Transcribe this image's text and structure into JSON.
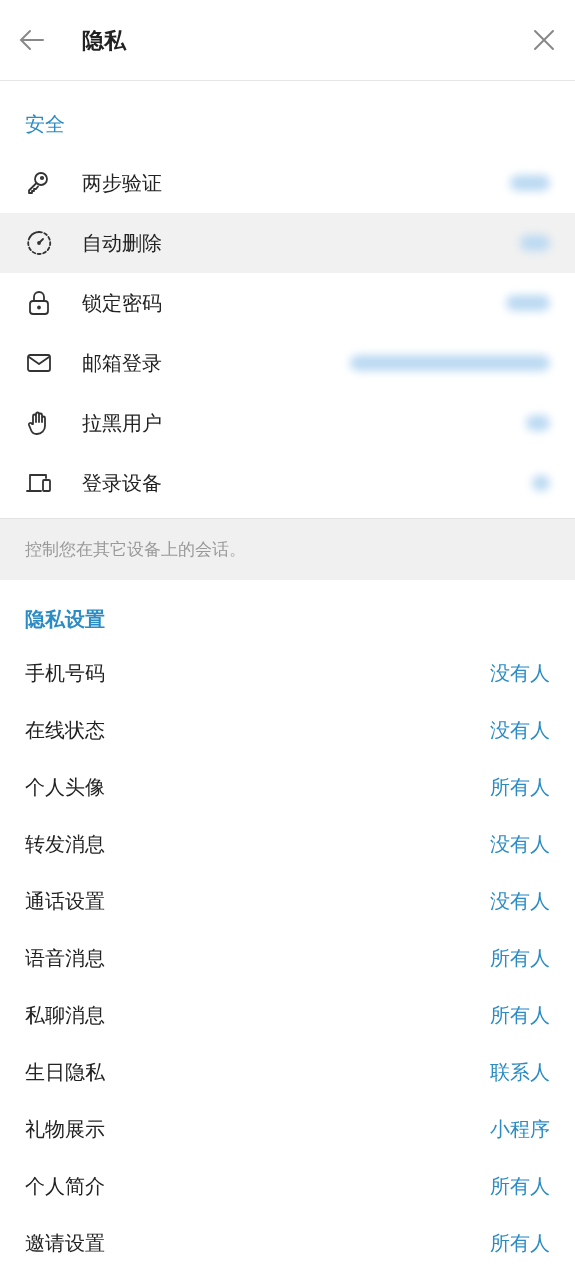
{
  "header": {
    "title": "隐私"
  },
  "security": {
    "title": "安全",
    "items": [
      {
        "label": "两步验证",
        "highlighted": false
      },
      {
        "label": "自动删除",
        "highlighted": true
      },
      {
        "label": "锁定密码",
        "highlighted": false
      },
      {
        "label": "邮箱登录",
        "highlighted": false
      },
      {
        "label": "拉黑用户",
        "highlighted": false
      },
      {
        "label": "登录设备",
        "highlighted": false
      }
    ],
    "footer": "控制您在其它设备上的会话。"
  },
  "privacy": {
    "title": "隐私设置",
    "items": [
      {
        "label": "手机号码",
        "value": "没有人"
      },
      {
        "label": "在线状态",
        "value": "没有人"
      },
      {
        "label": "个人头像",
        "value": "所有人"
      },
      {
        "label": "转发消息",
        "value": "没有人"
      },
      {
        "label": "通话设置",
        "value": "没有人"
      },
      {
        "label": "语音消息",
        "value": "所有人"
      },
      {
        "label": "私聊消息",
        "value": "所有人"
      },
      {
        "label": "生日隐私",
        "value": "联系人"
      },
      {
        "label": "礼物展示",
        "value": "小程序"
      },
      {
        "label": "个人简介",
        "value": "所有人"
      },
      {
        "label": "邀请设置",
        "value": "所有人"
      }
    ]
  }
}
